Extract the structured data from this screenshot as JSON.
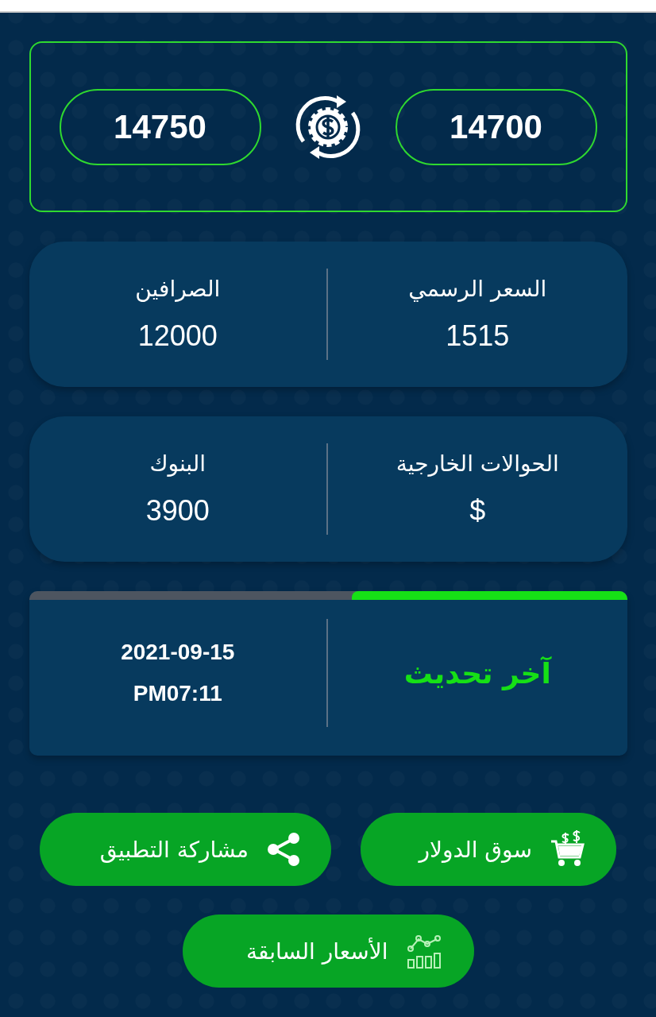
{
  "rates": [
    "14700",
    "14750"
  ],
  "stat_cards": [
    {
      "items": [
        {
          "label": "السعر الرسمي",
          "value": "1515"
        },
        {
          "label": "الصرافين",
          "value": "12000"
        }
      ]
    },
    {
      "items": [
        {
          "label": "الحوالات الخارجية",
          "value": "$"
        },
        {
          "label": "البنوك",
          "value": "3900"
        }
      ]
    }
  ],
  "last_update": {
    "label": "آخر تحديث",
    "date": "2021-09-15",
    "time": "PM07:11",
    "level": 0.46
  },
  "buttons": [
    {
      "kind": "cart",
      "label": "سوق الدولار"
    },
    {
      "kind": "share",
      "label": "مشاركة التطبيق"
    },
    {
      "kind": "chart",
      "label": "الأسعار السابقة"
    }
  ]
}
